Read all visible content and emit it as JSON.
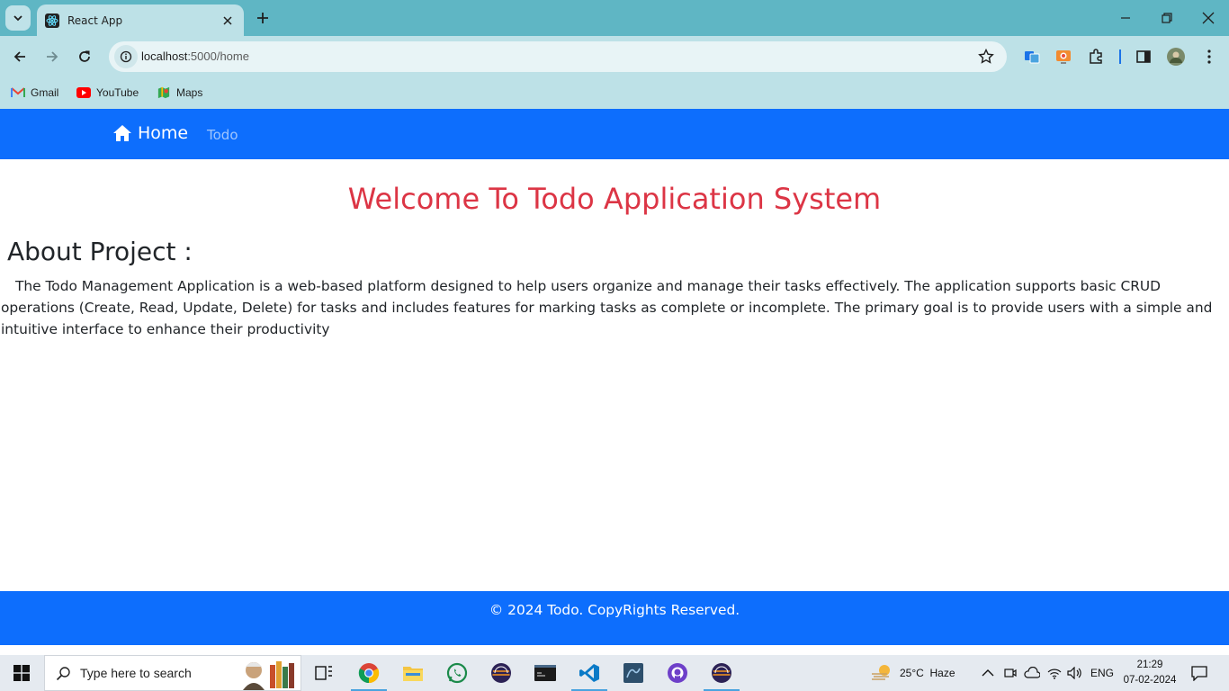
{
  "browser": {
    "tab_title": "React App",
    "url_host": "localhost",
    "url_path": ":5000/home",
    "bookmarks": [
      {
        "label": "Gmail",
        "icon": "gmail-icon"
      },
      {
        "label": "YouTube",
        "icon": "youtube-icon"
      },
      {
        "label": "Maps",
        "icon": "maps-icon"
      }
    ]
  },
  "navbar": {
    "brand": "Home",
    "link_todo": "Todo"
  },
  "main": {
    "heading": "Welcome To Todo Application System",
    "about_title": "About Project :",
    "description": "The Todo Management Application is a web-based platform designed to help users organize and manage their tasks effectively. The application supports basic CRUD operations (Create, Read, Update, Delete) for tasks and includes features for marking tasks as complete or incomplete. The primary goal is to provide users with a simple and intuitive interface to enhance their productivity"
  },
  "footer": {
    "text": "© 2024 Todo. CopyRights Reserved."
  },
  "taskbar": {
    "search_placeholder": "Type here to search",
    "weather": "25°C  Haze",
    "language": "ENG",
    "time": "21:29",
    "date": "07-02-2024"
  },
  "colors": {
    "primary": "#0d6efd",
    "heading_red": "#dc3545",
    "chrome_bg": "#5fb6c4"
  }
}
